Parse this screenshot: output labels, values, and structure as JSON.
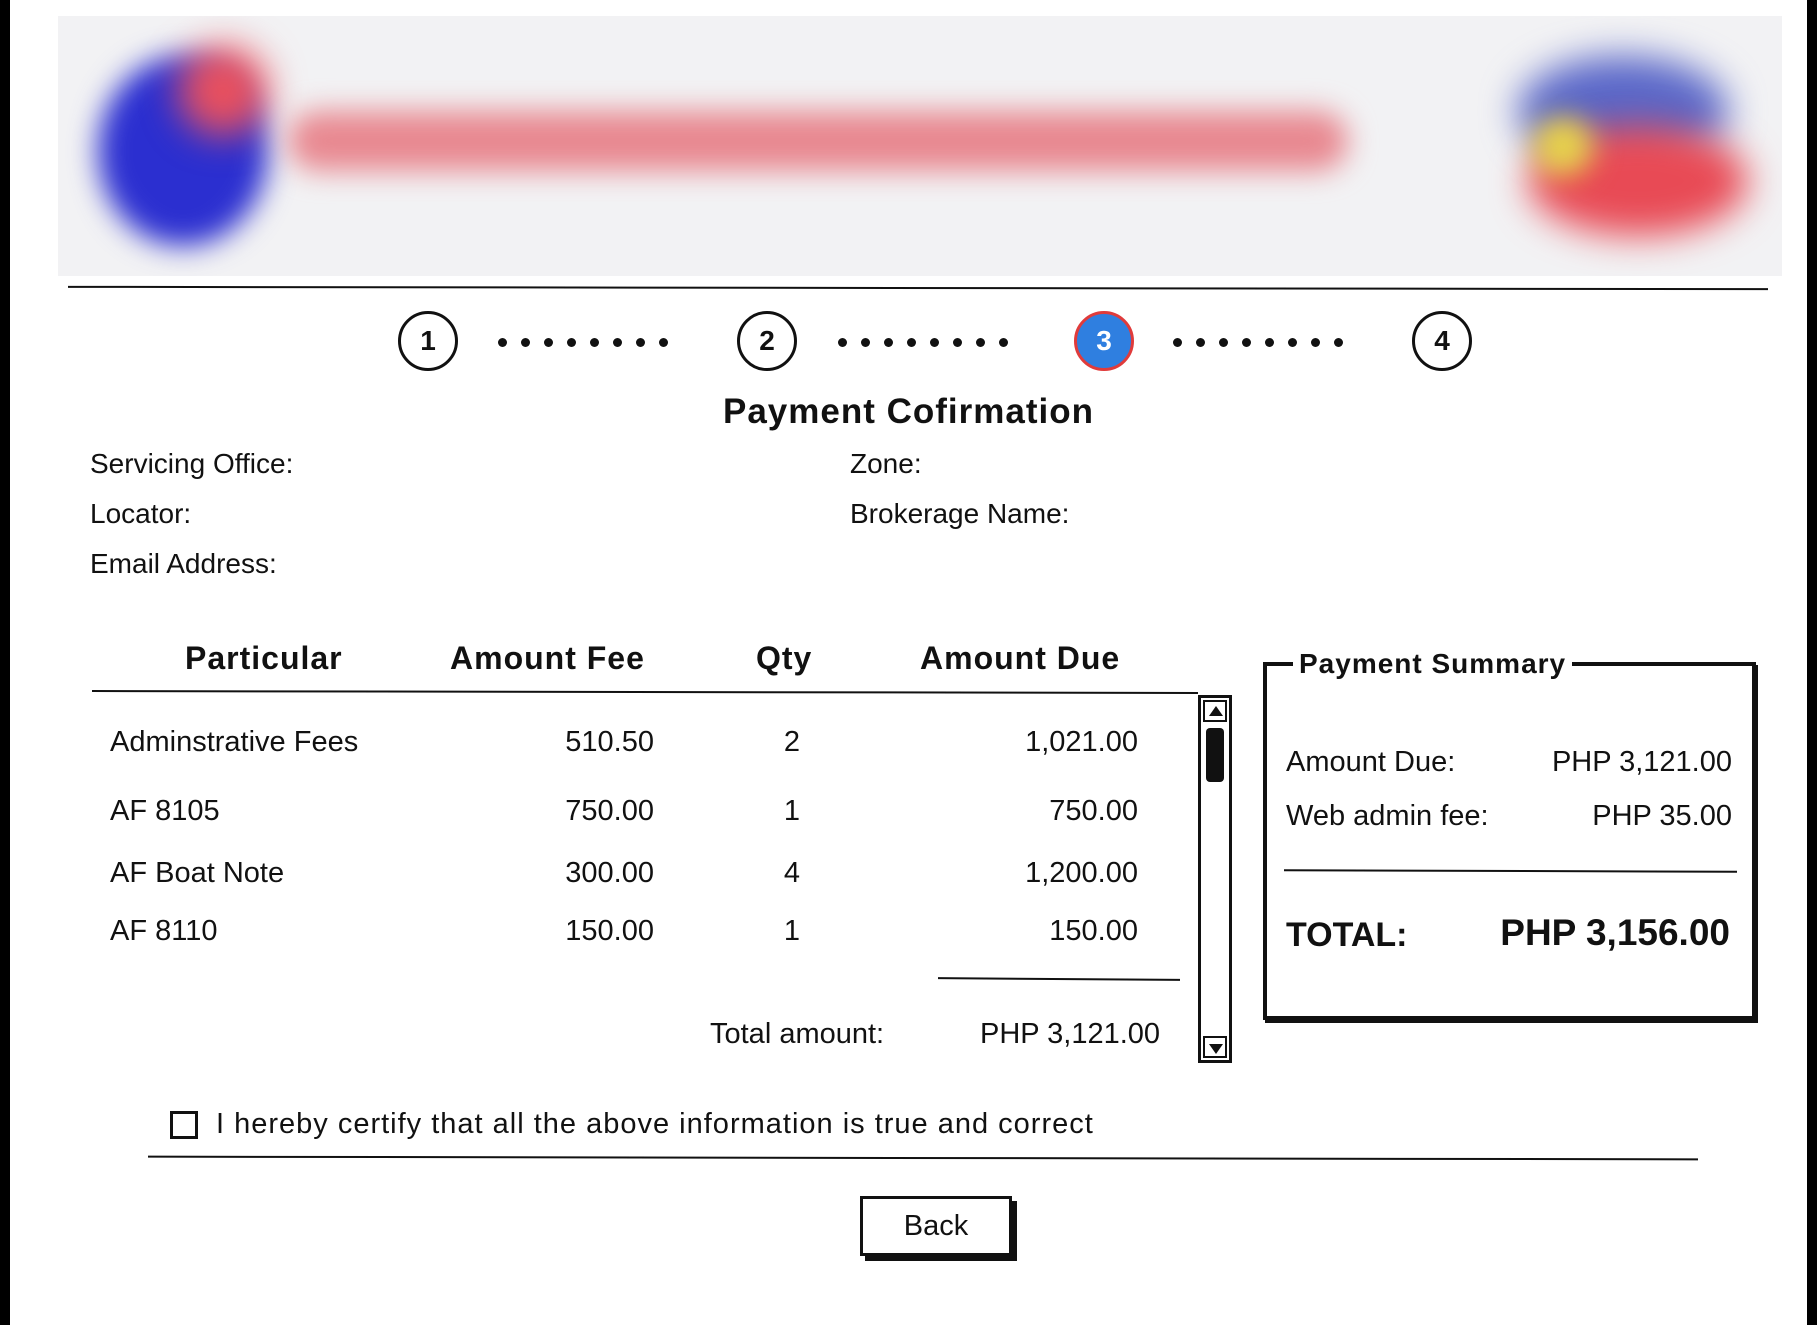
{
  "stepper": {
    "steps": [
      "1",
      "2",
      "3",
      "4"
    ],
    "active_step": "3"
  },
  "page_title": "Payment Cofirmation",
  "info": {
    "servicing_office_label": "Servicing Office:",
    "zone_label": "Zone:",
    "locator_label": "Locator:",
    "brokerage_name_label": "Brokerage Name:",
    "email_label": "Email Address:"
  },
  "table": {
    "headers": [
      "Particular",
      "Amount Fee",
      "Qty",
      "Amount Due"
    ],
    "rows": [
      {
        "particular": "Adminstrative Fees",
        "fee": "510.50",
        "qty": "2",
        "due": "1,021.00"
      },
      {
        "particular": "AF 8105",
        "fee": "750.00",
        "qty": "1",
        "due": "750.00"
      },
      {
        "particular": "AF Boat Note",
        "fee": "300.00",
        "qty": "4",
        "due": "1,200.00"
      },
      {
        "particular": "AF 8110",
        "fee": "150.00",
        "qty": "1",
        "due": "150.00"
      }
    ],
    "total_label": "Total amount:",
    "total_value": "PHP 3,121.00"
  },
  "summary": {
    "legend": "Payment Summary",
    "amount_due_label": "Amount Due:",
    "amount_due_value": "PHP 3,121.00",
    "web_fee_label": "Web admin fee:",
    "web_fee_value": "PHP 35.00",
    "total_label": "TOTAL:",
    "total_value": "PHP 3,156.00"
  },
  "certify_text": "I hereby certify that all the above information is true and correct",
  "back_label": "Back",
  "colors": {
    "active_step_fill": "#2f7fe0",
    "active_step_border": "#e03b3b"
  }
}
